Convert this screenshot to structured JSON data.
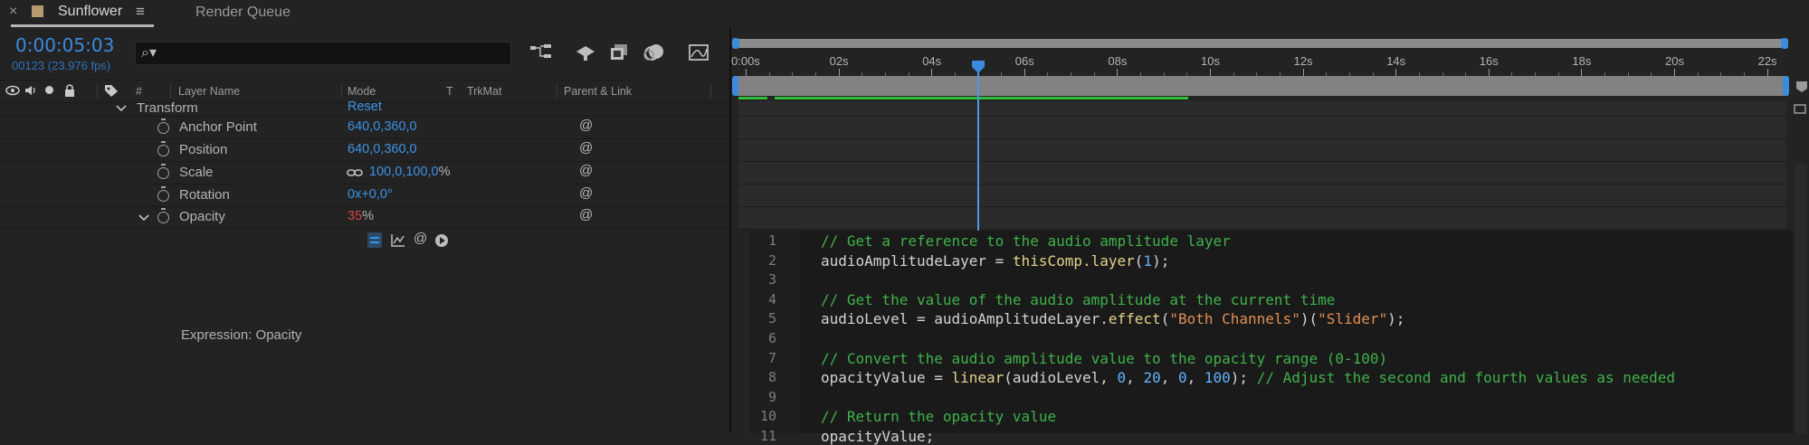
{
  "tabs": {
    "close_glyph": "×",
    "comp_tab": "Sunflower",
    "menu_glyph": "≡",
    "render_queue": "Render Queue",
    "comp_color": "#b59a6c"
  },
  "comp": {
    "timecode": "0:00:05:03",
    "frames": "00123 (23.976 fps)",
    "search_glyph": "⌕▾"
  },
  "columns": {
    "hash": "#",
    "layer_name": "Layer Name",
    "mode": "Mode",
    "t": "T",
    "trkmat": "TrkMat",
    "parent_link": "Parent & Link"
  },
  "transform": {
    "label": "Transform",
    "reset": "Reset"
  },
  "properties": [
    {
      "name": "Anchor Point",
      "value": "640,0,360,0"
    },
    {
      "name": "Position",
      "value": "640,0,360,0"
    },
    {
      "name": "Scale",
      "value": "100,0,100,0",
      "unit": "%"
    },
    {
      "name": "Rotation",
      "value": "0x+0,0°"
    },
    {
      "name": "Opacity",
      "value": "35",
      "unit": "%"
    }
  ],
  "expression_label": "Expression: Opacity",
  "timeline": {
    "ticks": [
      "0:00s",
      "02s",
      "04s",
      "06s",
      "08s",
      "10s",
      "12s",
      "14s",
      "16s",
      "18s",
      "20s",
      "22s"
    ],
    "playhead_fraction": 0.231,
    "work_area_end_fraction": 0.43,
    "accent": "#3b8bdc",
    "work_area_color": "#2fbd3a"
  },
  "code_lines": [
    {
      "n": "1",
      "parts": [
        {
          "t": "// Get a reference to the audio amplitude layer",
          "c": "cm"
        }
      ]
    },
    {
      "n": "2",
      "parts": [
        {
          "t": "audioAmplitudeLayer = ",
          "c": ""
        },
        {
          "t": "thisComp.layer",
          "c": "fn"
        },
        {
          "t": "(",
          "c": ""
        },
        {
          "t": "1",
          "c": "nm"
        },
        {
          "t": ");",
          "c": ""
        }
      ]
    },
    {
      "n": "3",
      "parts": []
    },
    {
      "n": "4",
      "parts": [
        {
          "t": "// Get the value of the audio amplitude at the current time",
          "c": "cm"
        }
      ]
    },
    {
      "n": "5",
      "parts": [
        {
          "t": "audioLevel = audioAmplitudeLayer.",
          "c": ""
        },
        {
          "t": "effect",
          "c": "fn"
        },
        {
          "t": "(",
          "c": ""
        },
        {
          "t": "\"Both Channels\"",
          "c": "st"
        },
        {
          "t": ")(",
          "c": ""
        },
        {
          "t": "\"Slider\"",
          "c": "st"
        },
        {
          "t": ");",
          "c": ""
        }
      ]
    },
    {
      "n": "6",
      "parts": []
    },
    {
      "n": "7",
      "parts": [
        {
          "t": "// Convert the audio amplitude value to the opacity range (0-100)",
          "c": "cm"
        }
      ]
    },
    {
      "n": "8",
      "parts": [
        {
          "t": "opacityValue = ",
          "c": ""
        },
        {
          "t": "linear",
          "c": "fn"
        },
        {
          "t": "(audioLevel, ",
          "c": ""
        },
        {
          "t": "0",
          "c": "nm"
        },
        {
          "t": ", ",
          "c": ""
        },
        {
          "t": "20",
          "c": "nm"
        },
        {
          "t": ", ",
          "c": ""
        },
        {
          "t": "0",
          "c": "nm"
        },
        {
          "t": ", ",
          "c": ""
        },
        {
          "t": "100",
          "c": "nm"
        },
        {
          "t": "); ",
          "c": ""
        },
        {
          "t": "// Adjust the second and fourth values as needed",
          "c": "cm"
        }
      ]
    },
    {
      "n": "9",
      "parts": []
    },
    {
      "n": "10",
      "parts": [
        {
          "t": "// Return the opacity value",
          "c": "cm"
        }
      ]
    },
    {
      "n": "11",
      "parts": [
        {
          "t": "opacityValue;",
          "c": ""
        }
      ]
    }
  ]
}
